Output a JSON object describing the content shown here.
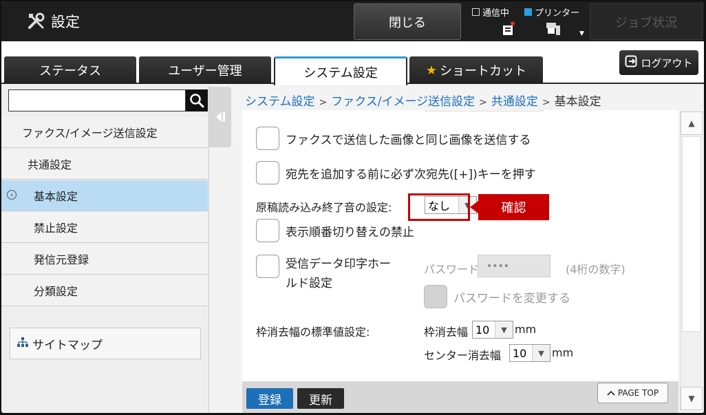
{
  "header": {
    "title": "設定",
    "close_label": "閉じる",
    "status_comm": "通信中",
    "status_printer": "プリンター",
    "job_status_label": "ジョブ状況",
    "accent_blue": "#2ba0dc"
  },
  "tabs": [
    {
      "label": "ステータス"
    },
    {
      "label": "ユーザー管理"
    },
    {
      "label": "システム設定",
      "active": true
    },
    {
      "label": "ショートカット"
    }
  ],
  "logout_label": "ログアウト",
  "sidebar": {
    "search_value": "",
    "items": [
      {
        "label": "ファクス/イメージ送信設定"
      },
      {
        "label": "共通設定"
      },
      {
        "label": "基本設定",
        "active": true
      },
      {
        "label": "禁止設定"
      },
      {
        "label": "発信元登録"
      },
      {
        "label": "分類設定"
      }
    ],
    "sitemap_label": "サイトマップ"
  },
  "breadcrumb": {
    "items": [
      "システム設定",
      "ファクス/イメージ送信設定",
      "共通設定"
    ],
    "current": "基本設定",
    "sep": ">"
  },
  "form": {
    "same_image_label": "ファクスで送信した画像と同じ画像を送信する",
    "next_address_label": "宛先を追加する前に必ず次宛先([+])キーを押す",
    "scan_end_sound_label": "原稿読み込み終了音の設定:",
    "scan_end_sound_value": "なし",
    "confirm_label": "確認",
    "display_order_label": "表示順番切り替えの禁止",
    "hold_label_line1": "受信データ印字ホー",
    "hold_label_line2": "ルド設定",
    "password_label": "パスワード:",
    "password_value": "••••",
    "password_hint": "(4桁の数字)",
    "change_password_label": "パスワードを変更する",
    "erase_width_label": "枠消去幅の標準値設定:",
    "frame_erase_label": "枠消去幅",
    "frame_erase_value": "10",
    "center_erase_label": "センター消去幅",
    "center_erase_value": "10",
    "unit_mm": "mm"
  },
  "actions": {
    "register_label": "登録",
    "update_label": "更新",
    "page_top_label": "PAGE TOP"
  }
}
